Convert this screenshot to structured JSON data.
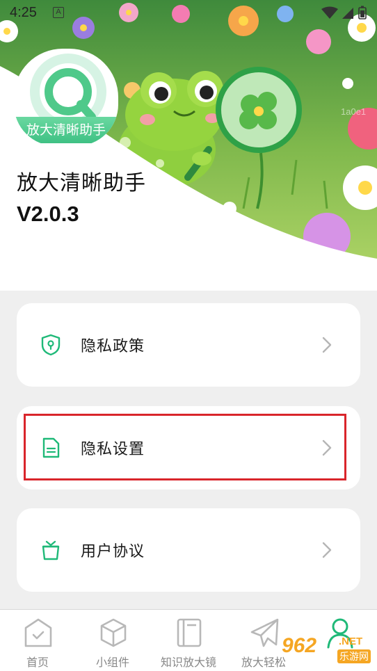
{
  "status_bar": {
    "time": "4:25",
    "notification_letter": "A"
  },
  "hero": {
    "logo_caption": "放大清晰助手",
    "watermark_code": "1a0e1",
    "app_name": "放大清晰助手",
    "version": "V2.0.3"
  },
  "menu": {
    "items": [
      {
        "label": "隐私政策",
        "icon": "shield-icon",
        "chevron": "chevron-right-icon"
      },
      {
        "label": "隐私设置",
        "icon": "document-icon",
        "chevron": "chevron-right-icon"
      },
      {
        "label": "用户协议",
        "icon": "basket-icon",
        "chevron": "chevron-right-icon"
      }
    ]
  },
  "bottom_nav": {
    "items": [
      {
        "label": "首页",
        "icon": "home-icon"
      },
      {
        "label": "小组件",
        "icon": "cube-icon"
      },
      {
        "label": "知识放大镜",
        "icon": "book-icon"
      },
      {
        "label": "放大轻松",
        "icon": "paper-plane-icon"
      },
      {
        "label": "",
        "icon": "person-icon"
      }
    ],
    "active_color": "#1fb978"
  },
  "watermark": {
    "brand": "962",
    "tld": ".NET",
    "site": "乐游网"
  },
  "colors": {
    "accent": "#1fb978",
    "highlight_border": "#d9252b",
    "page_bg": "#efefef"
  }
}
